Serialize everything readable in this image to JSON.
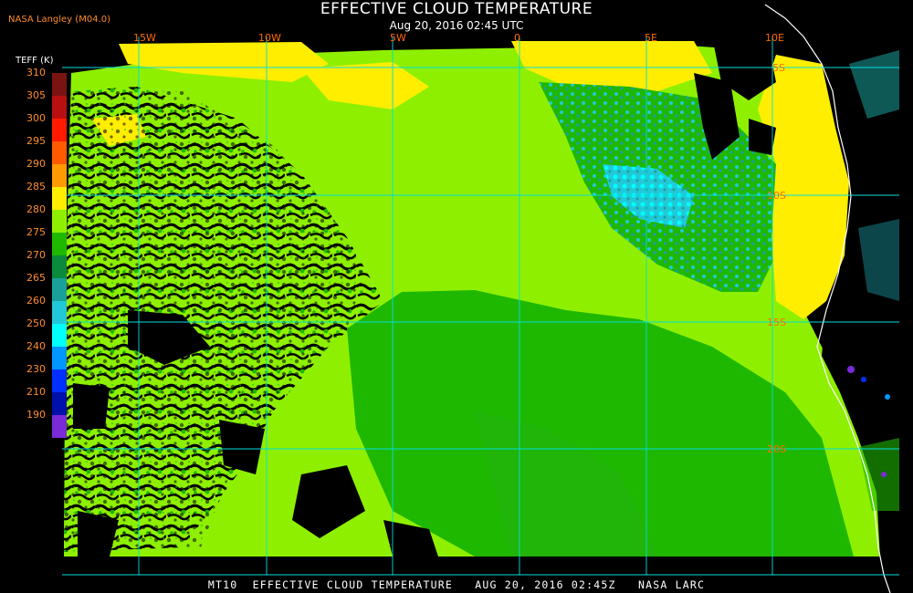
{
  "header": {
    "title": "EFFECTIVE CLOUD TEMPERATURE",
    "subtitle": "Aug 20, 2016 02:45 UTC",
    "producer": "NASA Langley (M04.0)"
  },
  "colorbar": {
    "title": "TEFF (K)",
    "labels": [
      "310",
      "305",
      "300",
      "295",
      "290",
      "285",
      "280",
      "275",
      "270",
      "265",
      "260",
      "250",
      "240",
      "230",
      "210",
      "190"
    ],
    "colors": [
      "#7a1410",
      "#b81010",
      "#ff1a00",
      "#ff5a00",
      "#ff9a00",
      "#ffee00",
      "#8ef000",
      "#1fb800",
      "#0a8a3a",
      "#1aa09a",
      "#22c8d8",
      "#00ffff",
      "#0096ff",
      "#0030ff",
      "#0010aa",
      "#7a2ad8"
    ]
  },
  "map": {
    "lon_labels": [
      "15W",
      "10W",
      "5W",
      "0",
      "5E",
      "10E"
    ],
    "lat_labels": [
      "5S",
      "10S",
      "15S",
      "20S"
    ],
    "grid_color": "#00dede",
    "label_color": "#ff6a00"
  },
  "footer": {
    "text": "MT10  EFFECTIVE CLOUD TEMPERATURE   AUG 20, 2016 02:45Z   NASA LARC"
  }
}
